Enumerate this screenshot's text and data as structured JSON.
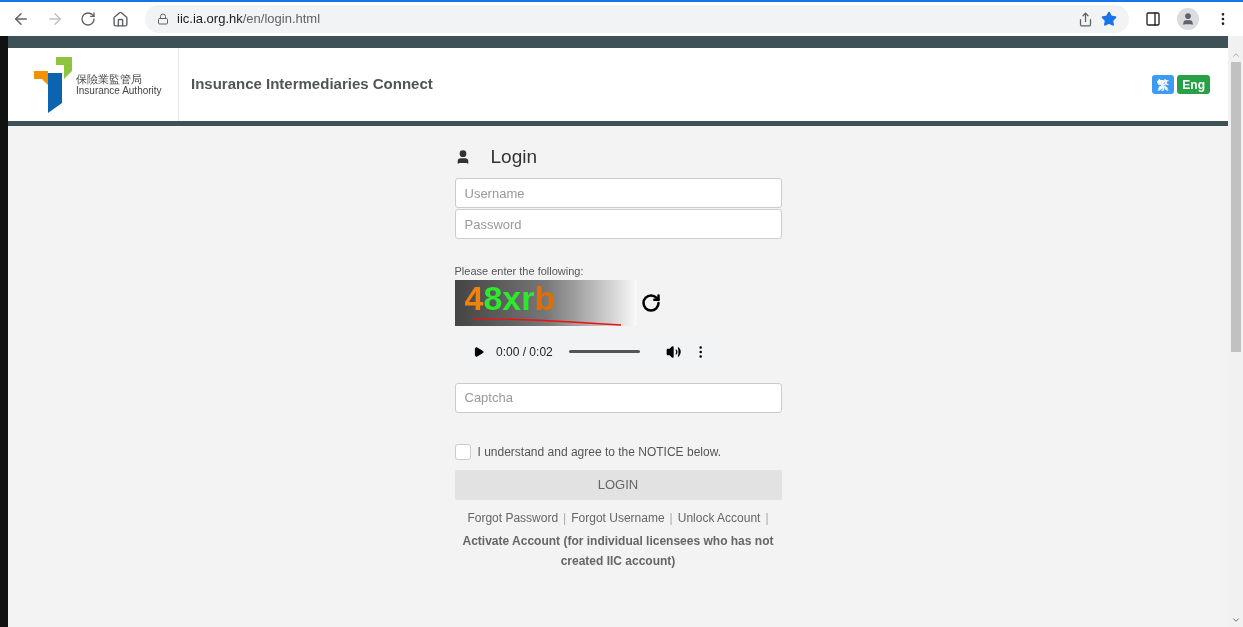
{
  "browser": {
    "url_host": "iic.ia.org.hk",
    "url_path": "/en/login.html",
    "bookmarked": true
  },
  "header": {
    "logo_chinese": "保險業監管局",
    "logo_english": "Insurance Authority",
    "site_title": "Insurance Intermediaries Connect",
    "languages": [
      {
        "label": "繁",
        "color": "#3d9bf0"
      },
      {
        "label": "Eng",
        "color": "#28a046"
      }
    ]
  },
  "login": {
    "title": "Login",
    "fields": [
      {
        "placeholder": "Username"
      },
      {
        "placeholder": "Password"
      }
    ],
    "captcha_prompt": "Please enter the following:",
    "captcha": {
      "characters": [
        {
          "char": "4",
          "color": "#f0820a"
        },
        {
          "char": "8",
          "color": "#2ee82e"
        },
        {
          "char": "x",
          "color": "#2ee82e"
        },
        {
          "char": "r",
          "color": "#2ee82e"
        },
        {
          "char": "b",
          "color": "#e06f00"
        }
      ]
    },
    "audio": {
      "time": "0:00 / 0:02"
    },
    "captcha_field": {
      "placeholder": "Captcha"
    },
    "agree": {
      "label": "I understand and agree to the NOTICE below.",
      "checked": false
    },
    "login_button": {
      "label": "LOGIN",
      "disabled": true
    },
    "separator": "|",
    "links": [
      {
        "label": "Forgot Password",
        "bold": false
      },
      {
        "label": "Forgot Username",
        "bold": false
      },
      {
        "label": "Unlock Account",
        "bold": false
      },
      {
        "label": "Activate Account (for individual licensees who has not created IIC account)",
        "bold": true
      }
    ]
  }
}
